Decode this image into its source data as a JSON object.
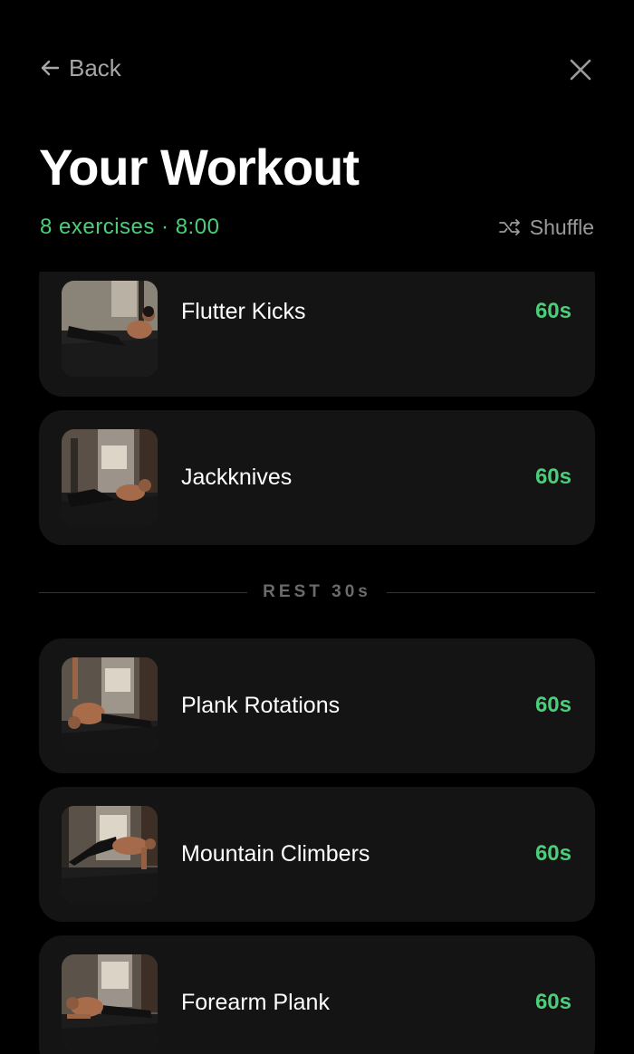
{
  "header": {
    "back_label": "Back",
    "title": "Your Workout",
    "summary": "8 exercises · 8:00",
    "shuffle_label": "Shuffle"
  },
  "exercises": [
    {
      "name": "Flutter Kicks",
      "duration": "60s",
      "icon": "flutter-kicks-photo"
    },
    {
      "name": "Jackknives",
      "duration": "60s",
      "icon": "jackknives-photo"
    },
    {
      "name": "Plank Rotations",
      "duration": "60s",
      "icon": "plank-rotations-photo"
    },
    {
      "name": "Mountain Climbers",
      "duration": "60s",
      "icon": "mountain-climbers-photo"
    },
    {
      "name": "Forearm Plank",
      "duration": "60s",
      "icon": "forearm-plank-photo"
    }
  ],
  "rest": {
    "label": "REST 30s"
  },
  "colors": {
    "accent": "#4ccd7a",
    "background": "#000000",
    "card": "#141414",
    "muted_text": "#9a9a9a"
  }
}
